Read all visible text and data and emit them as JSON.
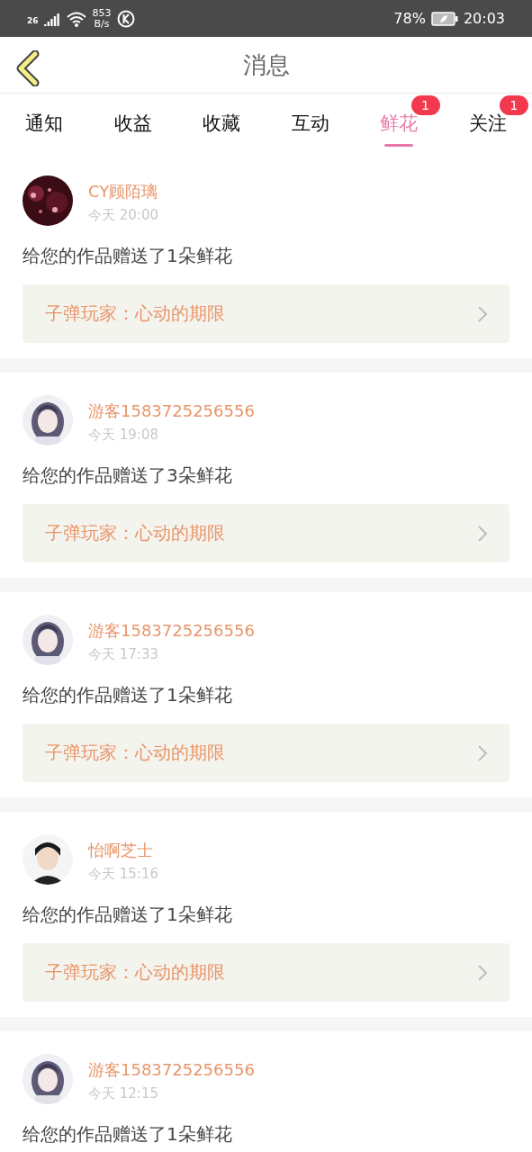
{
  "status_bar": {
    "network": "26",
    "speed": [
      "853",
      "B/s"
    ],
    "battery": "78%",
    "time": "20:03"
  },
  "header": {
    "title": "消息"
  },
  "tabs": [
    {
      "label": "通知",
      "selected": false
    },
    {
      "label": "收益",
      "selected": false
    },
    {
      "label": "收藏",
      "selected": false
    },
    {
      "label": "互动",
      "selected": false
    },
    {
      "label": "鲜花",
      "selected": true,
      "badge": "1"
    },
    {
      "label": "关注",
      "selected": false,
      "badge": "1"
    }
  ],
  "messages": [
    {
      "user": "CY顾陌璃",
      "time": "今天 20:00",
      "text": "给您的作品赠送了1朵鲜花",
      "work": "子弹玩家：心动的期限"
    },
    {
      "user": "游客1583725256556",
      "time": "今天 19:08",
      "text": "给您的作品赠送了3朵鲜花",
      "work": "子弹玩家：心动的期限"
    },
    {
      "user": "游客1583725256556",
      "time": "今天 17:33",
      "text": "给您的作品赠送了1朵鲜花",
      "work": "子弹玩家：心动的期限"
    },
    {
      "user": "怡啊芝士",
      "time": "今天 15:16",
      "text": "给您的作品赠送了1朵鲜花",
      "work": "子弹玩家：心动的期限"
    },
    {
      "user": "游客1583725256556",
      "time": "今天 12:15",
      "text": "给您的作品赠送了1朵鲜花"
    }
  ]
}
